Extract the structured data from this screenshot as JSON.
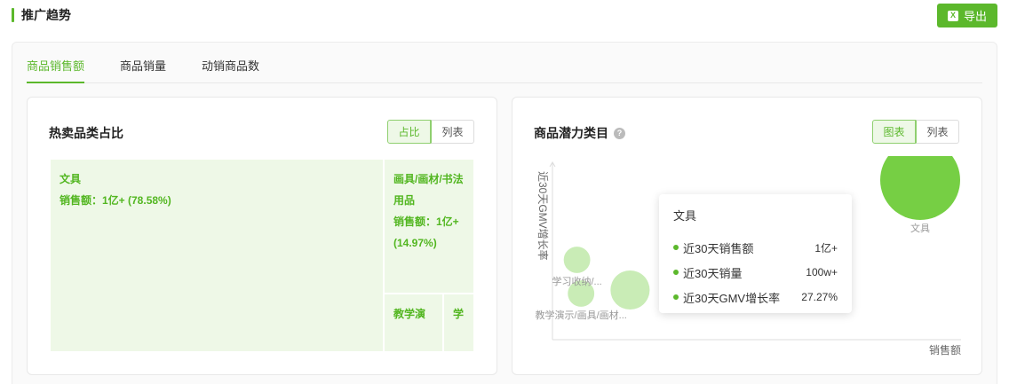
{
  "header": {
    "title": "推广趋势",
    "export_label": "导出"
  },
  "tabs": [
    {
      "label": "商品销售额",
      "active": true
    },
    {
      "label": "商品销量",
      "active": false
    },
    {
      "label": "动销商品数",
      "active": false
    }
  ],
  "left_card": {
    "title": "热卖品类占比",
    "toggle": [
      {
        "label": "占比",
        "active": true
      },
      {
        "label": "列表",
        "active": false
      }
    ],
    "treemap": [
      {
        "name": "文具",
        "sales": "销售额：1亿+ (78.58%)",
        "share": 78.58
      },
      {
        "name": "画具/画材/书法用品",
        "sales": "销售额：1亿+ (14.97%)",
        "share": 14.97
      },
      {
        "name": "教学演",
        "sales": "",
        "share": 4.5
      },
      {
        "name": "学",
        "sales": "",
        "share": 1.95
      }
    ]
  },
  "right_card": {
    "title": "商品潜力类目",
    "toggle": [
      {
        "label": "图表",
        "active": true
      },
      {
        "label": "列表",
        "active": false
      }
    ],
    "chart_data": {
      "type": "scatter",
      "xlabel": "销售额",
      "ylabel": "近30天GMV增长率",
      "points": [
        {
          "label": "文具",
          "x": 0.9,
          "y": 0.9,
          "size": 1.0
        },
        {
          "label": "学习收纳/...",
          "x": 0.06,
          "y": 0.45,
          "size": 0.11
        },
        {
          "label": "教学演示/画具/画材...",
          "x": 0.07,
          "y": 0.26,
          "size": 0.11
        },
        {
          "label": "",
          "x": 0.19,
          "y": 0.28,
          "size": 0.24
        }
      ],
      "colors": {
        "primary": "#76cf44",
        "light": "#c9ecb6"
      }
    },
    "tooltip": {
      "title": "文具",
      "rows": [
        {
          "label": "近30天销售额",
          "value": "1亿+"
        },
        {
          "label": "近30天销量",
          "value": "100w+"
        },
        {
          "label": "近30天GMV增长率",
          "value": "27.27%"
        }
      ]
    }
  }
}
